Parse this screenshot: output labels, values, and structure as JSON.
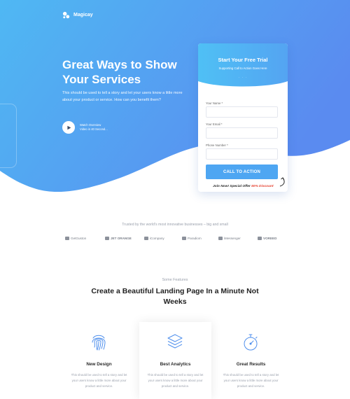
{
  "brand": {
    "name": "Magicay",
    "icon": "magicay-logo-icon"
  },
  "hero": {
    "title": "Great Ways to Show Your Services",
    "description": "This should be used to tell a story and let your users know a little more about your product or service. How can you benefit them?",
    "video_cta": {
      "line1": "Watch Overview",
      "line2": "Video in 40 Second...",
      "icon": "play-icon"
    },
    "gradient": {
      "start": "#4fb6f2",
      "end": "#5b8cf0"
    }
  },
  "form": {
    "title": "Start Your Free Trial",
    "subtitle": "Supporting Call to Action Goes Here",
    "fields": [
      {
        "label": "Your Name *",
        "value": ""
      },
      {
        "label": "Your Email *",
        "value": ""
      },
      {
        "label": "Phone Number *",
        "value": ""
      }
    ],
    "submit_label": "CALL TO ACTION",
    "offer_text": "Join Now! Special Offer",
    "offer_discount": "50% Discount",
    "accent": "#4ea6f2",
    "discount_color": "#e5402f"
  },
  "trusted": {
    "text": "Trusted by the world's most innovative businesses – big and small",
    "brands": [
      "GetGuston",
      "JET ORANGE",
      "iCompany",
      "Paradiom",
      "iMessenger",
      "VOREED"
    ]
  },
  "features": {
    "kicker": "Some Features",
    "title": "Create a Beautiful Landing Page In a Minute Not Weeks",
    "items": [
      {
        "name": "New Design",
        "icon": "fingerprint-icon",
        "description": "This should be used to tell a story and let your users know a little more about your product and service."
      },
      {
        "name": "Best Analytics",
        "icon": "layers-icon",
        "description": "This should be used to tell a story and let your users know a little more about your product and service."
      },
      {
        "name": "Great Results",
        "icon": "stopwatch-icon",
        "description": "This should be used to tell a story and let your users know a little more about your product and service."
      }
    ]
  }
}
